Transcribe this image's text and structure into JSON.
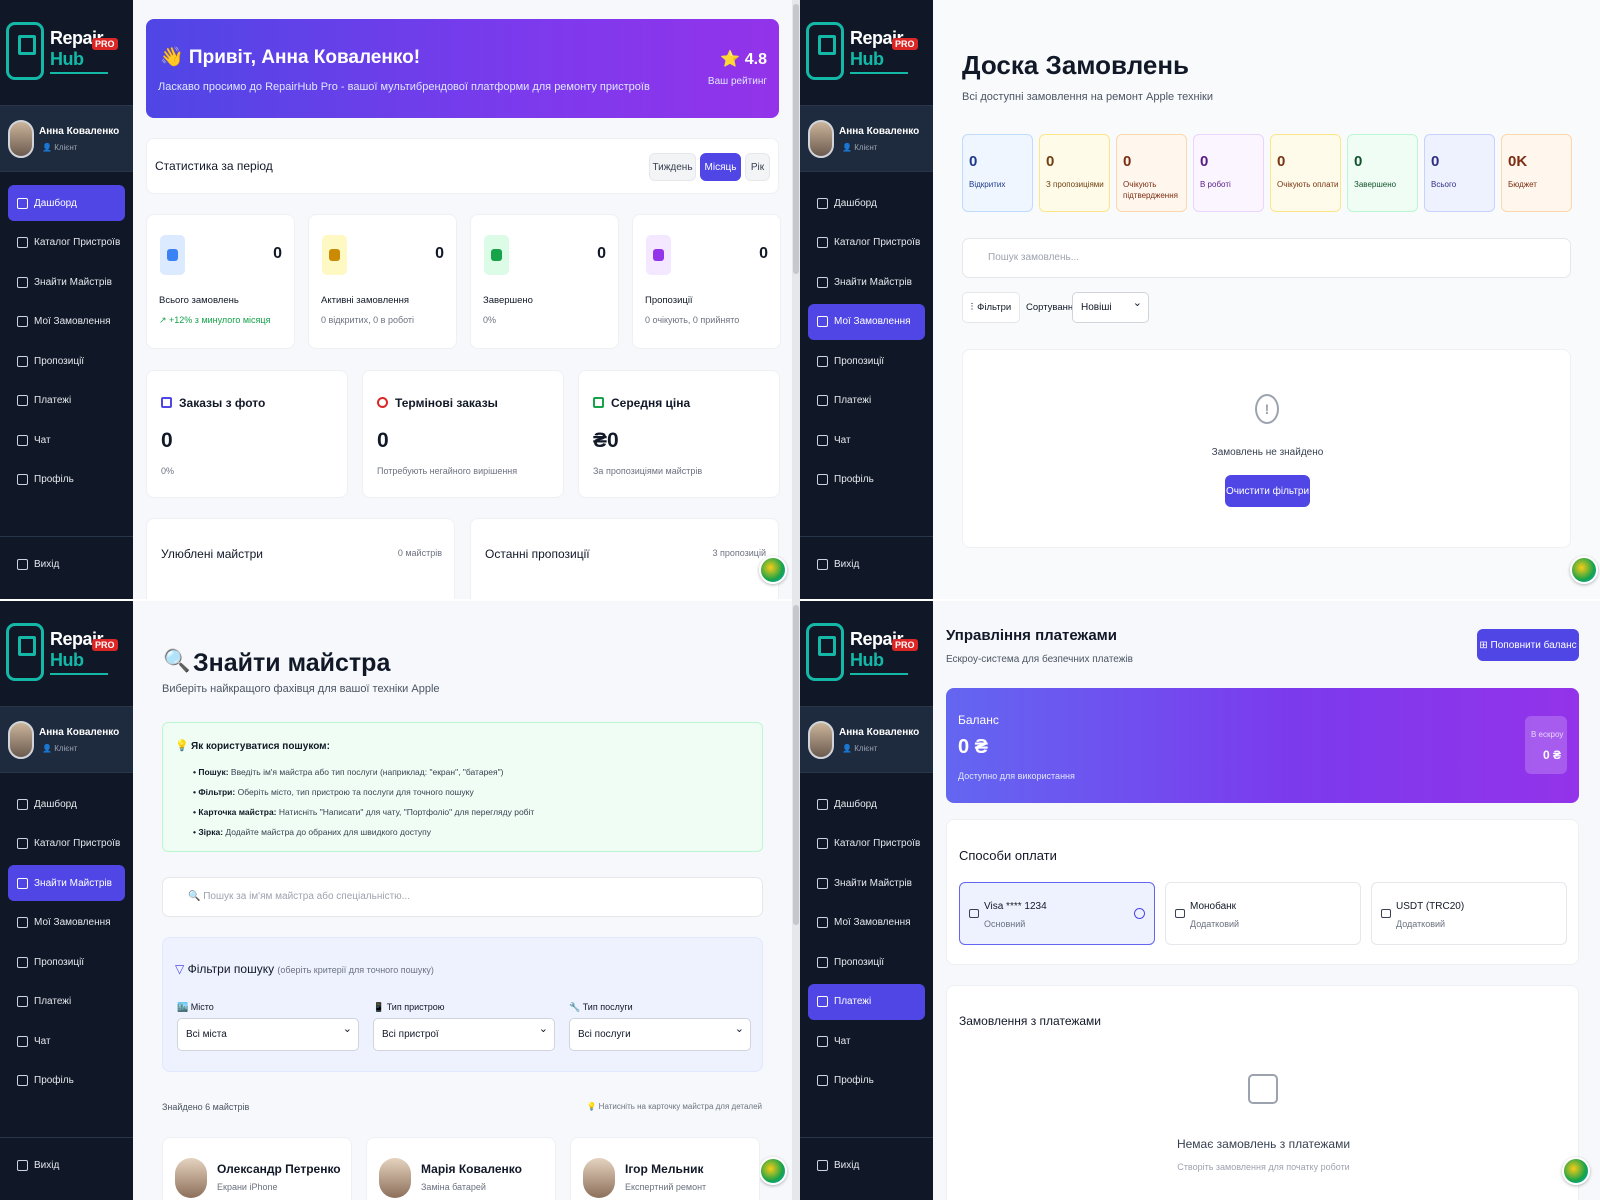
{
  "brand": {
    "name1": "Repair",
    "name2": "Hub",
    "badge": "PRO"
  },
  "user": {
    "name": "Анна Коваленко",
    "role": "Клієнт"
  },
  "nav": [
    "Дашборд",
    "Каталог Пристроїв",
    "Знайти Майстрів",
    "Мої Замовлення",
    "Пропозиції",
    "Платежі",
    "Чат",
    "Профіль"
  ],
  "logout": "Вихід",
  "dashboard": {
    "greeting": "👋 Привіт, Анна Коваленко!",
    "welcome": "Ласкаво просимо до RepairHub Pro - вашої мультибрендової платформи для ремонту пристроїв",
    "rating": "⭐ 4.8",
    "rating_label": "Ваш рейтинг",
    "period_title": "Статистика за період",
    "periods": [
      "Тиждень",
      "Місяць",
      "Рік"
    ],
    "active_period": "Місяць",
    "stats": [
      {
        "value": "0",
        "label": "Всього замовлень",
        "sub": "↗ +12% з минулого місяця",
        "color": "#dbeafe"
      },
      {
        "value": "0",
        "label": "Активні замовлення",
        "sub": "0 відкритих, 0 в роботі",
        "color": "#fef9c3"
      },
      {
        "value": "0",
        "label": "Завершено",
        "sub": "0%",
        "color": "#dcfce7"
      },
      {
        "value": "0",
        "label": "Пропозиції",
        "sub": "0 очікують, 0 прийнято",
        "color": "#f3e8ff"
      }
    ],
    "metrics": [
      {
        "title": "Заказы з фото",
        "value": "0",
        "sub": "0%"
      },
      {
        "title": "Термінові заказы",
        "value": "0",
        "sub": "Потребують негайного вирішення"
      },
      {
        "title": "Середня ціна",
        "value": "₴0",
        "sub": "За пропозиціями майстрів"
      }
    ],
    "favorites": {
      "title": "Улюблені майстри",
      "count": "0 майстрів"
    },
    "offers": {
      "title": "Останні пропозиції",
      "count": "3 пропозицій"
    }
  },
  "orders": {
    "title": "Доска Замовлень",
    "subtitle": "Всі доступні замовлення на ремонт Apple техніки",
    "kpis": [
      {
        "value": "0",
        "label": "Відкритих",
        "bg": "#eff6ff",
        "border": "#bfdbfe",
        "color": "#1e3a8a"
      },
      {
        "value": "0",
        "label": "З пропозиціями",
        "bg": "#fefce8",
        "border": "#fde68a",
        "color": "#713f12"
      },
      {
        "value": "0",
        "label": "Очікують підтвердження",
        "bg": "#fff7ed",
        "border": "#fed7aa",
        "color": "#7c2d12"
      },
      {
        "value": "0",
        "label": "В роботі",
        "bg": "#faf5ff",
        "border": "#e9d5ff",
        "color": "#581c87"
      },
      {
        "value": "0",
        "label": "Очікують оплати",
        "bg": "#fffbeb",
        "border": "#fde68a",
        "color": "#78350f"
      },
      {
        "value": "0",
        "label": "Завершено",
        "bg": "#f0fdf4",
        "border": "#bbf7d0",
        "color": "#14532d"
      },
      {
        "value": "0",
        "label": "Всього",
        "bg": "#eef2ff",
        "border": "#c7d2fe",
        "color": "#312e81"
      },
      {
        "value": "0K",
        "label": "Бюджет",
        "bg": "#fff7ed",
        "border": "#fed7aa",
        "color": "#7c2d12"
      }
    ],
    "search_placeholder": "Пошук замовлень...",
    "filters": "Фільтри",
    "sort_label": "Сортування:",
    "sort_value": "Новіші",
    "empty": "Замовлень не знайдено",
    "clear": "Очистити фільтри"
  },
  "masters": {
    "icon": "🔍",
    "title": "Знайти майстра",
    "subtitle": "Виберіть найкращого фахівця для вашої техніки Apple",
    "help_title": "Як користуватися пошуком:",
    "help": [
      {
        "k": "• Пошук:",
        "v": " Введіть ім'я майстра або тип послуги (наприклад: \"екран\", \"батарея\")"
      },
      {
        "k": "• Фільтри:",
        "v": " Оберіть місто, тип пристрою та послуги для точного пошуку"
      },
      {
        "k": "• Карточка майстра:",
        "v": " Натисніть \"Написати\" для чату, \"Портфоліо\" для перегляду робіт"
      },
      {
        "k": "• Зірка:",
        "v": " Додайте майстра до обраних для швидкого доступу"
      }
    ],
    "search_placeholder": "🔍 Пошук за ім'ям майстра або спеціальністю...",
    "filter_title": "Фільтри пошуку",
    "filter_hint": "(оберіть критерії для точного пошуку)",
    "filters": [
      {
        "label": "🏙️ Місто",
        "value": "Всі міста"
      },
      {
        "label": "📱 Тип пристрою",
        "value": "Всі пристрої"
      },
      {
        "label": "🔧 Тип послуги",
        "value": "Всі послуги"
      }
    ],
    "found": "Знайдено 6 майстрів",
    "tip": "💡 Натисніть на карточку майстра для деталей",
    "cards": [
      {
        "name": "Олександр Петренко",
        "spec": "Екрани iPhone"
      },
      {
        "name": "Марія Коваленко",
        "spec": "Заміна батарей"
      },
      {
        "name": "Ігор Мельник",
        "spec": "Експертний ремонт"
      }
    ]
  },
  "payments": {
    "title": "Управління платежами",
    "subtitle": "Ескроу-система для безпечних платежів",
    "topup": "⊞ Поповнити баланс",
    "balance_label": "Баланс",
    "balance": "0 ₴",
    "balance_sub": "Доступно для використання",
    "escrow_label": "В ескроу",
    "escrow": "0 ₴",
    "methods_title": "Способи оплати",
    "methods": [
      {
        "name": "Visa **** 1234",
        "sub": "Основний"
      },
      {
        "name": "Монобанк",
        "sub": "Додатковий"
      },
      {
        "name": "USDT (TRC20)",
        "sub": "Додатковий"
      }
    ],
    "orders_title": "Замовлення з платежами",
    "empty": "Немає замовлень з платежами",
    "empty_sub": "Створіть замовлення для початку роботи"
  }
}
